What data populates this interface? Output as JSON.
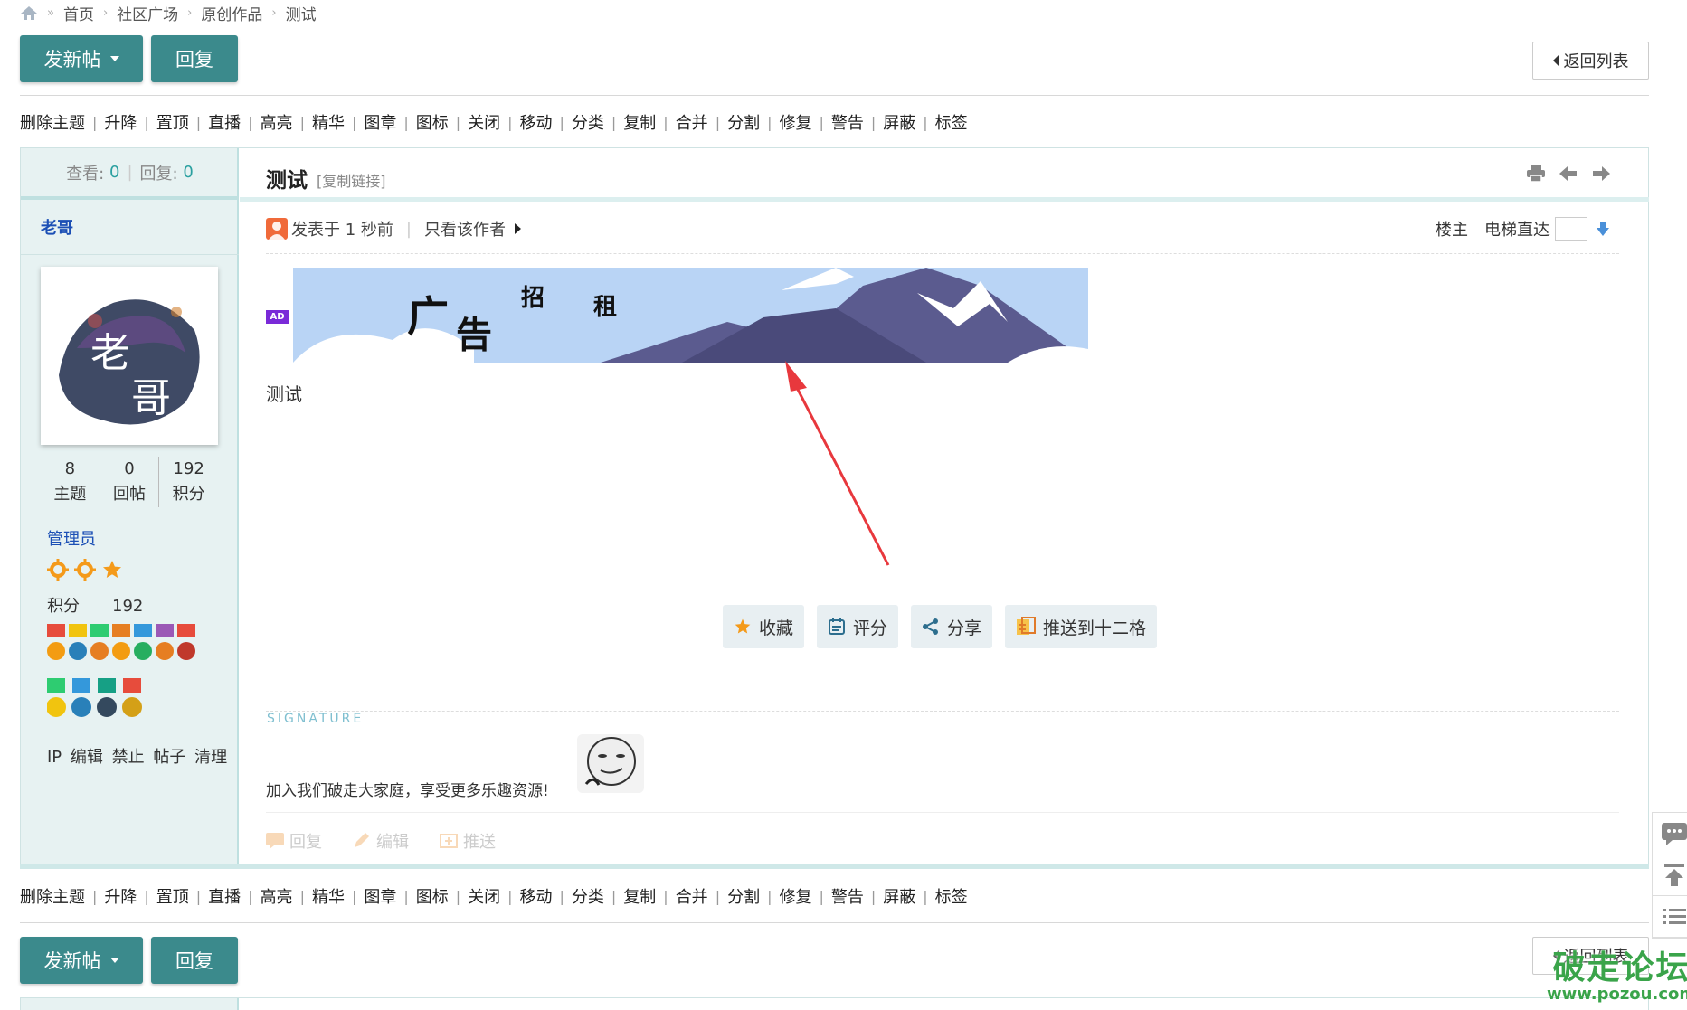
{
  "breadcrumb": [
    "首页",
    "社区广场",
    "原创作品",
    "测试"
  ],
  "buttons": {
    "new_thread": "发新帖",
    "reply": "回复",
    "back_to_list": "返回列表"
  },
  "mod_actions": [
    "删除主题",
    "升降",
    "置顶",
    "直播",
    "高亮",
    "精华",
    "图章",
    "图标",
    "关闭",
    "移动",
    "分类",
    "复制",
    "合并",
    "分割",
    "修复",
    "警告",
    "屏蔽",
    "标签"
  ],
  "thread": {
    "views_label": "查看:",
    "views": "0",
    "replies_label": "回复:",
    "replies": "0",
    "title": "测试",
    "copy_link": "[复制链接]",
    "posted": "发表于 1 秒前",
    "only_author": "只看该作者",
    "floor_label": "楼主",
    "jump_label": "电梯直达",
    "ad_tag": "AD",
    "ad_chars": [
      "广",
      "告",
      "招",
      "租"
    ],
    "content": "测试",
    "signature_title": "SIGNATURE",
    "signature_text": "加入我们破走大家庭，享受更多乐趣资源!"
  },
  "author": {
    "name": "老哥",
    "avatar_text": [
      "老",
      "哥"
    ],
    "stats": [
      {
        "value": "8",
        "label": "主题"
      },
      {
        "value": "0",
        "label": "回帖"
      },
      {
        "value": "192",
        "label": "积分"
      }
    ],
    "role": "管理员",
    "score_label": "积分",
    "score": "192",
    "admin_links": [
      "IP",
      "编辑",
      "禁止",
      "帖子",
      "清理"
    ]
  },
  "post_actions": [
    {
      "label": "收藏",
      "icon": "star-icon"
    },
    {
      "label": "评分",
      "icon": "calendar-icon"
    },
    {
      "label": "分享",
      "icon": "share-icon"
    },
    {
      "label": "推送到十二格",
      "icon": "push-icon"
    }
  ],
  "footer_actions": [
    "回复",
    "编辑",
    "推送"
  ],
  "watermark": {
    "big": "破走论坛",
    "small": "www.pozou.com"
  },
  "colors": {
    "primary": "#3b8a8c",
    "link": "#1b4fb5",
    "sidebar_bg": "#e7f2f2",
    "annotation_arrow": "#e8383d"
  }
}
